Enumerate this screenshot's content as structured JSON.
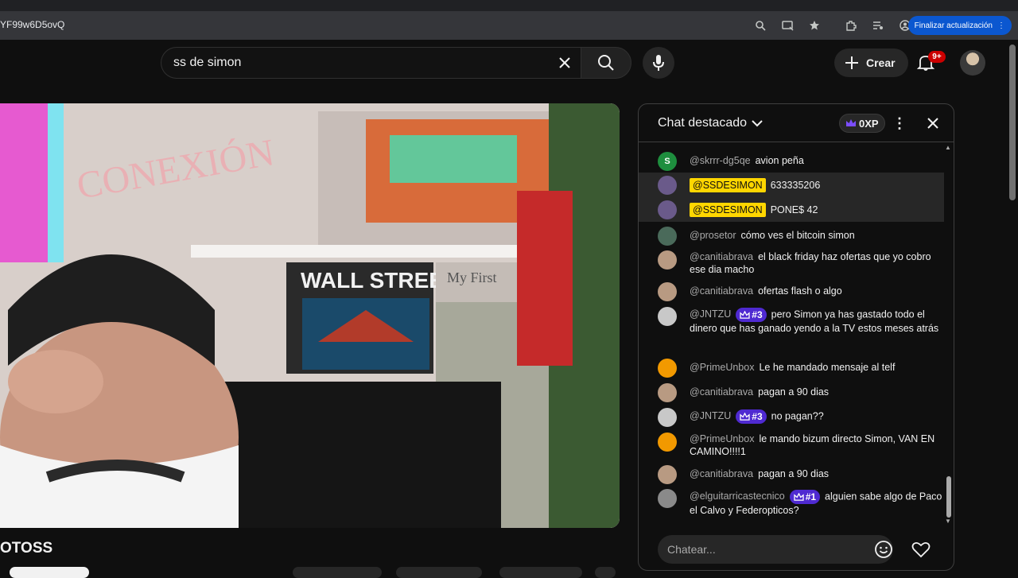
{
  "browser": {
    "url": "YF99w6D5ovQ",
    "update_label": "Finalizar actualización",
    "icons": [
      "zoom-icon",
      "cast-icon",
      "star-icon",
      "extensions-icon",
      "media-icon",
      "profile-icon"
    ]
  },
  "header": {
    "search_value": "ss de simon",
    "create_label": "Crear",
    "notif_badge": "9+"
  },
  "video": {
    "poster_wall_street": "WALL STREET",
    "poster_my_first": "My First",
    "wall_text": "CONEXIÓN"
  },
  "channel": {
    "name": "OTOSS"
  },
  "chat": {
    "title": "Chat destacado",
    "xp": "0XP",
    "input_placeholder": "Chatear...",
    "colors": {
      "owner_badge": "#ffd600",
      "member_badge": "#4f2ad1"
    },
    "messages": [
      {
        "author": "@skrrr-dg5qe",
        "text": "avion peña",
        "avatar": "S",
        "avatar_color": "#1e8e3e"
      },
      {
        "author": "@SSDESIMON",
        "text": "633335206",
        "owner": true,
        "avatar_color": "#6a5a8a"
      },
      {
        "author": "@SSDESIMON",
        "text": "PONE$ 42",
        "owner": true,
        "avatar_color": "#6a5a8a"
      },
      {
        "author": "@prosetor",
        "text": "cómo ves el bitcoin simon",
        "avatar_color": "#4a6a5a"
      },
      {
        "author": "@canitiabrava",
        "text": "el black friday haz ofertas que yo cobro ese dia macho",
        "avatar_color": "#b89a82"
      },
      {
        "author": "@canitiabrava",
        "text": "ofertas flash o algo",
        "avatar_color": "#b89a82"
      },
      {
        "author": "@JNTZU",
        "badge": "#3",
        "text": "pero Simon ya has gastado todo el dinero que has ganado yendo a la TV estos meses atrás",
        "avatar_color": "#c8c8c8"
      },
      {
        "author": "@PrimeUnbox",
        "text": "Le he mandado mensaje al telf",
        "avatar_color": "#f29900"
      },
      {
        "author": "@canitiabrava",
        "text": "pagan a 90 dias",
        "avatar_color": "#b89a82"
      },
      {
        "author": "@JNTZU",
        "badge": "#3",
        "text": "no pagan??",
        "avatar_color": "#c8c8c8"
      },
      {
        "author": "@PrimeUnbox",
        "text": "le mando bizum directo Simon, VAN EN CAMINO!!!!1",
        "avatar_color": "#f29900"
      },
      {
        "author": "@canitiabrava",
        "text": "pagan a 90 dias",
        "avatar_color": "#b89a82"
      },
      {
        "author": "@elguitarricastecnico",
        "badge": "#1",
        "text": "alguien sabe algo de Paco el Calvo y Federopticos?",
        "avatar_color": "#8a8a8a"
      }
    ]
  }
}
